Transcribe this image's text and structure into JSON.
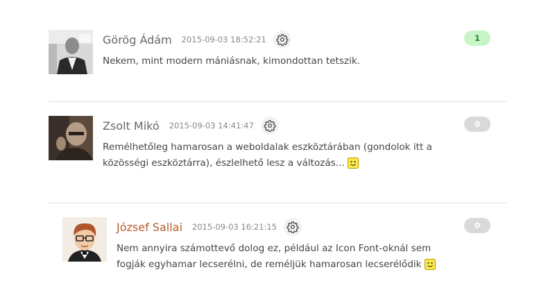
{
  "comments": [
    {
      "author": "Görög Ádám",
      "timestamp": "2015-09-03 18:52:21",
      "text": "Nekem, mint modern mániásnak, kimondottan tetszik.",
      "votes": "1",
      "avatar_icon": "user-photo-grayscale-avatar",
      "settings_icon": "gear-icon"
    },
    {
      "author": "Zsolt Mikó",
      "timestamp": "2015-09-03 14:41:47",
      "text_line1": "Remélhetőleg hamarosan a weboldalak eszköztárában (gondolok itt a",
      "text_line2": "közösségi eszköztárra), észlelhető lesz a változás...",
      "votes": "0",
      "avatar_icon": "user-photo-sepia-avatar",
      "settings_icon": "gear-icon",
      "emoticon": "smiley-icon"
    },
    {
      "author": "József Sallai",
      "timestamp": "2015-09-03 16:21:15",
      "text_line1": "Nem annyira számottevő dolog ez, például az Icon Font-oknál sem",
      "text_line2": "fogják egyhamar lecserélni, de reméljük hamarosan lecserélődik",
      "votes": "0",
      "avatar_icon": "cartoon-avatar",
      "settings_icon": "gear-icon",
      "emoticon": "smiley-icon"
    }
  ],
  "colors": {
    "author": "#666666",
    "owner_author": "#b85b2c",
    "vote_positive_bg": "#c8f5c8",
    "vote_neutral_bg": "#d9d9d9",
    "separator": "#e2e2e2"
  }
}
